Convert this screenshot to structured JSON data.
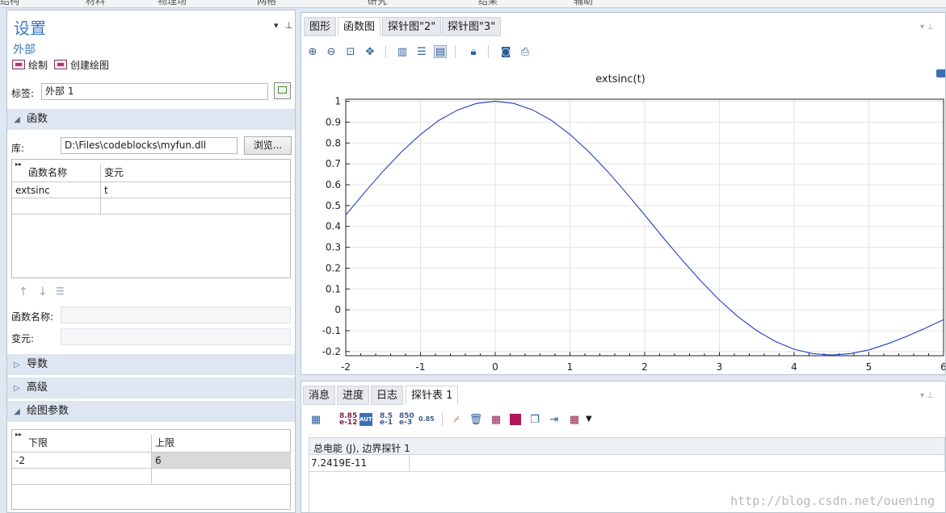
{
  "settings": {
    "title": "设置",
    "subtitle": "外部",
    "plot_button": "绘制",
    "create_plot_button": "创建绘图",
    "label_caption": "标签:",
    "label_value": "外部 1",
    "sections": {
      "functions": "函数",
      "derivatives": "导数",
      "advanced": "高级",
      "plot_params": "绘图参数"
    },
    "library_caption": "库:",
    "library_value": "D:\\Files\\codeblocks\\myfun.dll",
    "browse_button": "浏览...",
    "func_table": {
      "headers": [
        "函数名称",
        "变元"
      ],
      "rows": [
        [
          "extsinc",
          "t"
        ]
      ]
    },
    "func_name_caption": "函数名称:",
    "args_caption": "变元:",
    "plot_table": {
      "headers": [
        "下限",
        "上限"
      ],
      "rows": [
        [
          "-2",
          "6"
        ]
      ]
    }
  },
  "graphics": {
    "tabs": [
      "图形",
      "函数图",
      "探针图\"2\"",
      "探针图\"3\""
    ],
    "active_tab": 1
  },
  "chart_data": {
    "type": "line",
    "title": "extsinc(t)",
    "xlabel": "",
    "ylabel": "",
    "xlim": [
      -2,
      6
    ],
    "ylim": [
      -0.22,
      1.01
    ],
    "xticks": [
      "-2",
      "-1",
      "0",
      "1",
      "2",
      "3",
      "4",
      "5",
      "6"
    ],
    "yticks": [
      "1",
      "0.9",
      "0.8",
      "0.7",
      "0.6",
      "0.5",
      "0.4",
      "0.3",
      "0.2",
      "0.1",
      "0",
      "-0.1",
      "-0.2"
    ],
    "grid": true,
    "series": [
      {
        "color": "#1f3fbf",
        "x": [
          -2.0,
          -1.75,
          -1.5,
          -1.25,
          -1.0,
          -0.75,
          -0.5,
          -0.25,
          0.0,
          0.25,
          0.5,
          0.75,
          1.0,
          1.25,
          1.5,
          1.75,
          2.0,
          2.25,
          2.5,
          2.75,
          3.0,
          3.25,
          3.5,
          3.75,
          4.0,
          4.25,
          4.5,
          4.75,
          5.0,
          5.25,
          5.5,
          5.75,
          6.0
        ],
        "y": [
          0.455,
          0.562,
          0.665,
          0.759,
          0.841,
          0.909,
          0.959,
          0.99,
          1.0,
          0.99,
          0.959,
          0.909,
          0.841,
          0.759,
          0.665,
          0.562,
          0.455,
          0.345,
          0.239,
          0.139,
          0.047,
          -0.033,
          -0.1,
          -0.152,
          -0.189,
          -0.21,
          -0.217,
          -0.21,
          -0.192,
          -0.163,
          -0.128,
          -0.089,
          -0.047
        ]
      }
    ]
  },
  "messages": {
    "tabs": [
      "消息",
      "进度",
      "日志",
      "探针表 1"
    ],
    "active_tab": 3,
    "table_header": "总电能 (J), 边界探针 1",
    "table_value": "7.2419E-11",
    "toolbar_labels": [
      "8.85\ne-12",
      "AUTO",
      "8.5\ne-1",
      "850\ne-3",
      "0.85"
    ]
  },
  "watermark": "http://blog.csdn.net/ouening"
}
